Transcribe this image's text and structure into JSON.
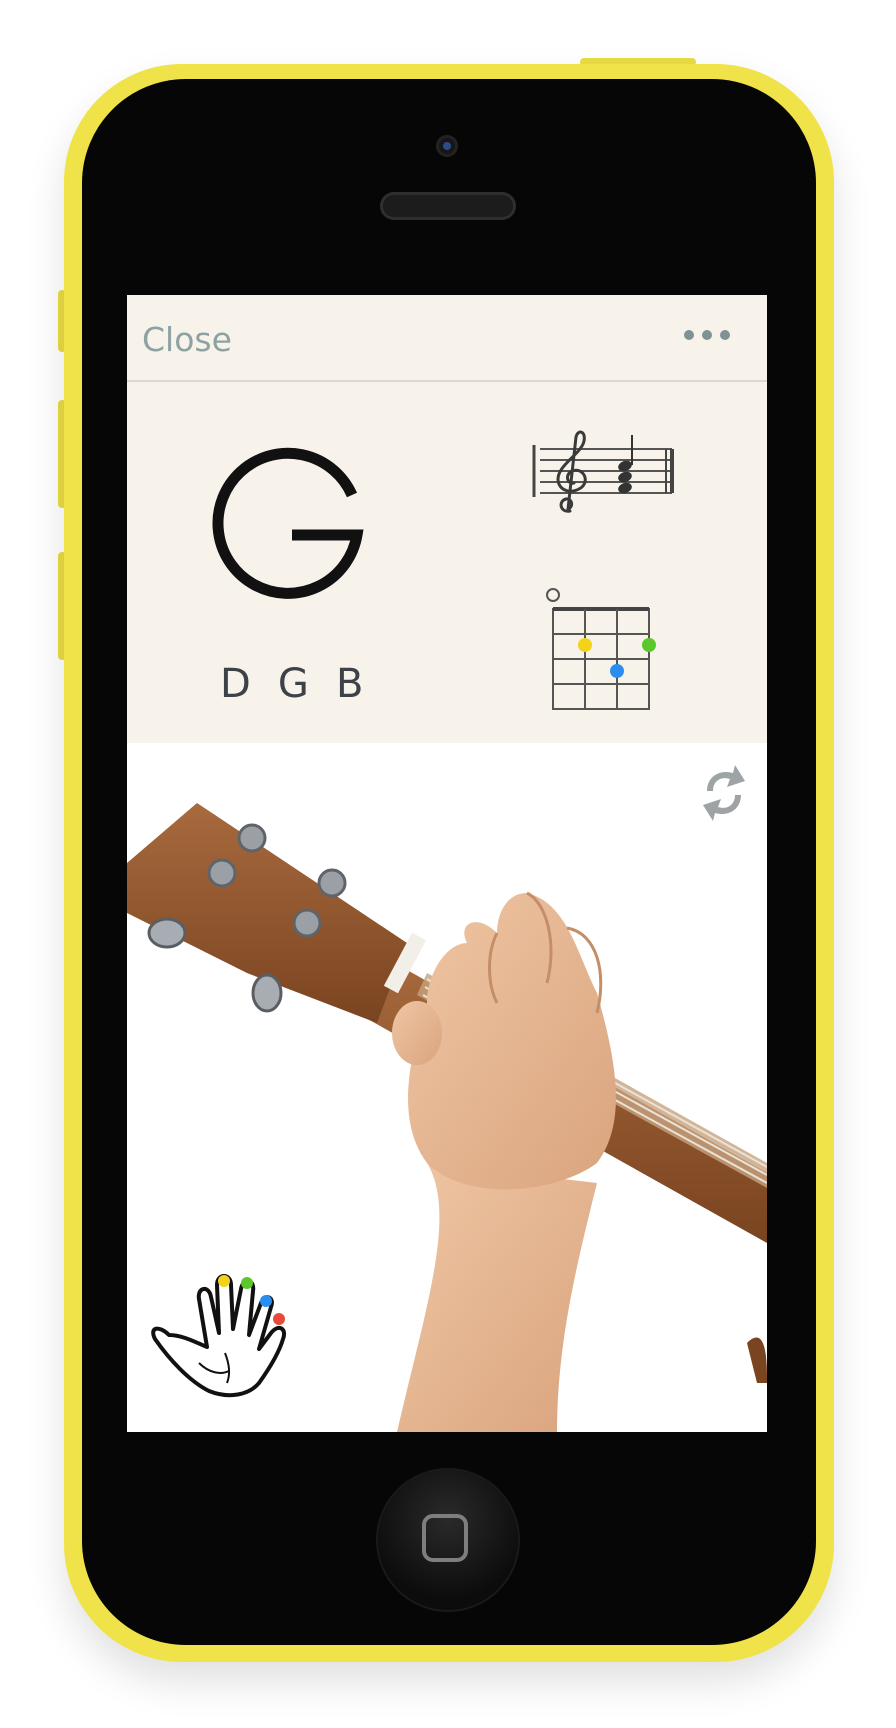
{
  "app": {
    "close_label": "Close",
    "more_icon": "more-horizontal-icon",
    "refresh_icon": "refresh-icon"
  },
  "chord": {
    "name": "G",
    "notes": "D G B",
    "staff_icon": "treble-clef-chord-icon",
    "diagram_icon": "ukulele-chord-diagram-icon",
    "fingering": {
      "open_string_marker": "o",
      "dots": [
        {
          "color": "#f2d21b",
          "finger": "index"
        },
        {
          "color": "#5cc72a",
          "finger": "middle"
        },
        {
          "color": "#2a8ef0",
          "finger": "ring"
        }
      ]
    }
  },
  "colors": {
    "phone_body": "#f0e34a",
    "card_background": "#f7f3ea",
    "accent_text": "#8fa2a3",
    "finger_yellow": "#f2d21b",
    "finger_green": "#5cc72a",
    "finger_blue": "#2a8ef0",
    "finger_red": "#e84a3a"
  },
  "photo": {
    "subject": "ukulele-hand-photo"
  },
  "hand_legend": {
    "icon": "hand-fingers-icon"
  }
}
